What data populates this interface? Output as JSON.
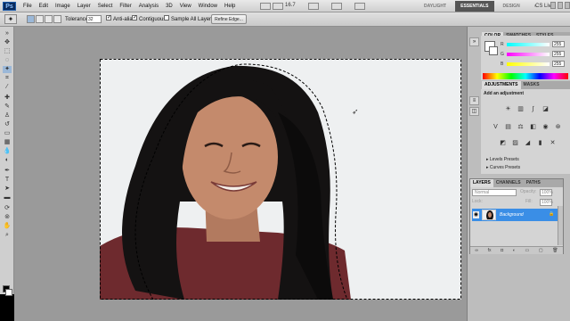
{
  "app": {
    "logo_text": "Ps",
    "menus": [
      "File",
      "Edit",
      "Image",
      "Layer",
      "Select",
      "Filter",
      "Analysis",
      "3D",
      "View",
      "Window",
      "Help"
    ],
    "zoom": "16.7",
    "workspaces": [
      "DAYLIGHT",
      "ESSENTIALS",
      "DESIGN"
    ],
    "workspace_more": "»",
    "cs_live": "CS Live"
  },
  "options_bar": {
    "tolerance_label": "Tolerance:",
    "tolerance_value": "32",
    "anti_alias_label": "Anti-alias",
    "anti_alias_checked": true,
    "contiguous_label": "Contiguous",
    "contiguous_checked": true,
    "sample_all_layers_label": "Sample All Layers",
    "sample_all_layers_checked": false,
    "refine_edge_label": "Refine Edge..."
  },
  "color_panel": {
    "tabs": [
      "COLOR",
      "SWATCHES",
      "STYLES"
    ],
    "channels": [
      {
        "label": "R",
        "value": "255"
      },
      {
        "label": "G",
        "value": "255"
      },
      {
        "label": "B",
        "value": "255"
      }
    ]
  },
  "adjustments_panel": {
    "tabs": [
      "ADJUSTMENTS",
      "MASKS"
    ],
    "title": "Add an adjustment",
    "presets": [
      "Levels Presets",
      "Curves Presets"
    ]
  },
  "layers_panel": {
    "tabs": [
      "LAYERS",
      "CHANNELS",
      "PATHS"
    ],
    "blend_mode": "Normal",
    "opacity_label": "Opacity:",
    "opacity_value": "100%",
    "lock_label": "Lock:",
    "fill_label": "Fill:",
    "fill_value": "100%",
    "layers": [
      {
        "name": "Background",
        "selected": true,
        "visible": true,
        "locked": true
      }
    ]
  },
  "colors": {
    "selection_blue": "#3a8ee6",
    "workspace_gray": "#9a9a9a",
    "foreground": "#000000",
    "background": "#ffffff"
  }
}
